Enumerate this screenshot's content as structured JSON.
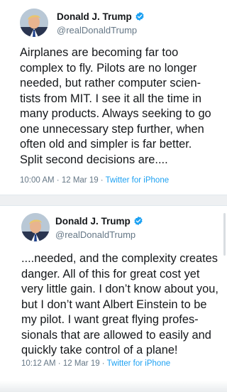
{
  "tweets": [
    {
      "display_name": "Donald J. Trump",
      "handle": "@realDonaldTrump",
      "verified_icon": "verified-badge-icon",
      "avatar_icon": "profile-photo",
      "text_lines": [
        "Airplanes are becoming far too",
        "complex to fly. Pilots are no longer",
        "needed, but rather computer scien-",
        "tists from MIT. I see it all the time in",
        "many products. Always seeking to go",
        "one unnecessary step further, when",
        "often old and simpler is far better.",
        "Split second decisions are...."
      ],
      "time": "10:00 AM",
      "date": "12 Mar 19",
      "source": "Twitter for iPhone"
    },
    {
      "display_name": "Donald J. Trump",
      "handle": "@realDonaldTrump",
      "verified_icon": "verified-badge-icon",
      "avatar_icon": "profile-photo",
      "text_lines": [
        "....needed, and the complexity creates",
        "danger. All of this for great cost yet",
        "very little gain. I don’t know about you,",
        "but I don’t want Albert Einstein to be",
        "my pilot. I want great flying profes-",
        "sionals that are allowed to easily and",
        "quickly take control of a plane!"
      ],
      "time": "10:12 AM",
      "date": "12 Mar 19",
      "source": "Twitter for iPhone"
    }
  ],
  "meta_separator": " · ",
  "colors": {
    "link": "#1da1f2",
    "muted": "#657786",
    "text": "#14171a",
    "verified": "#1da1f2"
  }
}
